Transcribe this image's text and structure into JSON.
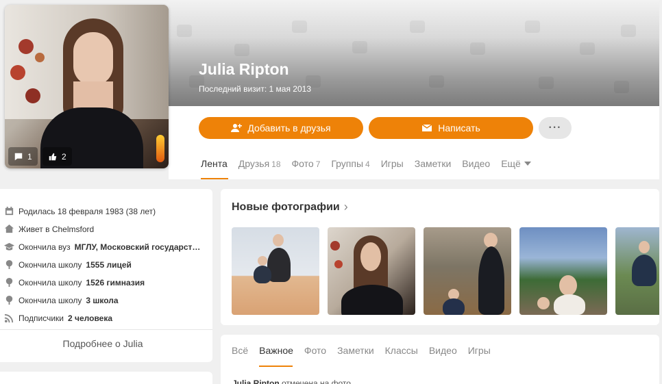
{
  "profile": {
    "name": "Julia Ripton",
    "last_visit": "Последний визит: 1 мая 2013",
    "avatar_comments": "1",
    "avatar_likes": "2"
  },
  "actions": {
    "add_friend": "Добавить в друзья",
    "write": "Написать",
    "more": "···"
  },
  "nav": {
    "items": [
      {
        "label": "Лента",
        "count": ""
      },
      {
        "label": "Друзья",
        "count": "18"
      },
      {
        "label": "Фото",
        "count": "7"
      },
      {
        "label": "Группы",
        "count": "4"
      },
      {
        "label": "Игры",
        "count": ""
      },
      {
        "label": "Заметки",
        "count": ""
      },
      {
        "label": "Видео",
        "count": ""
      },
      {
        "label": "Ещё",
        "count": ""
      }
    ],
    "active": "Лента"
  },
  "info": {
    "birth": "Родилась 18 февраля 1983 (38 лет)",
    "lives": "Живет в Chelmsford",
    "university_prefix": "Окончила вуз",
    "university": "МГЛУ, Московский государст…",
    "school_prefix": "Окончила школу",
    "school1": "1555 лицей",
    "school2": "1526 гимназия",
    "school3": "3 школа",
    "subscribers_prefix": "Подписчики",
    "subscribers": "2 человека",
    "more": "Подробнее о Julia"
  },
  "photos": {
    "title": "Новые фотографии",
    "arrow": "›"
  },
  "feed": {
    "tabs": [
      "Всё",
      "Важное",
      "Фото",
      "Заметки",
      "Классы",
      "Видео",
      "Игры"
    ],
    "active": "Важное",
    "note_name": "Julia Ripton",
    "note_text": " отмечена на фото"
  },
  "colors": {
    "accent": "#ee8208",
    "background": "#f0f0f0"
  }
}
